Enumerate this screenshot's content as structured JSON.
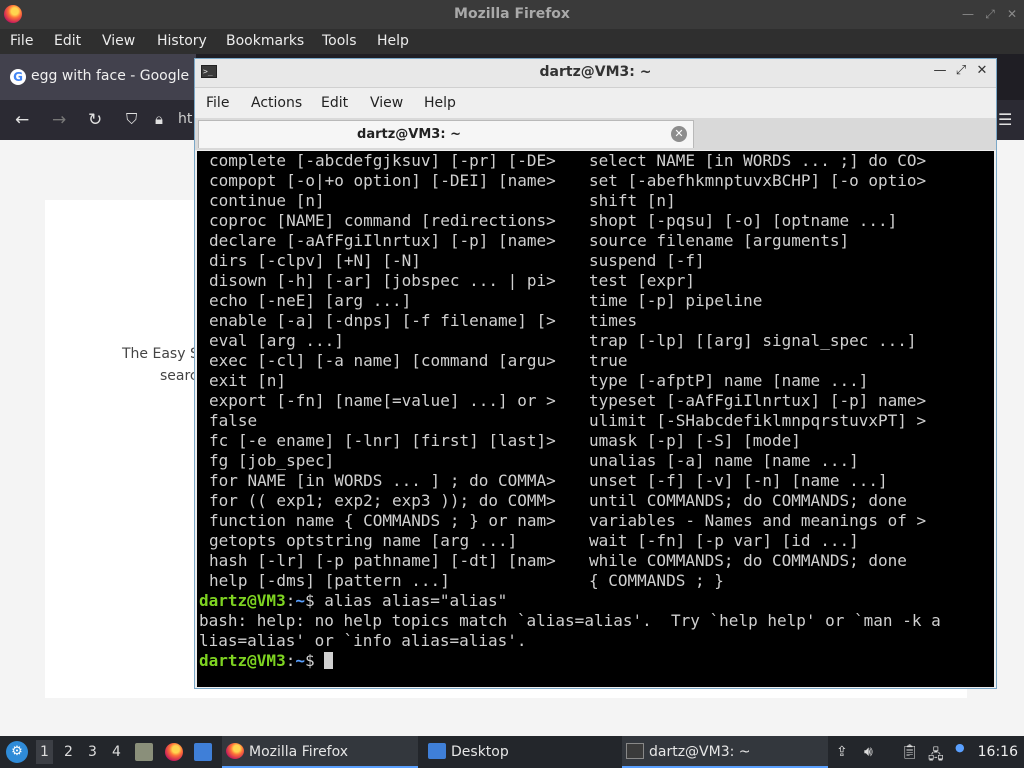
{
  "firefox": {
    "window_title": "Mozilla Firefox",
    "menu": [
      "File",
      "Edit",
      "View",
      "History",
      "Bookmarks",
      "Tools",
      "Help"
    ],
    "tab_title": "egg with face - Google S",
    "url_fragment": "ht",
    "page_text_1": "The Easy S",
    "page_text_2": "searc"
  },
  "terminal": {
    "window_title": "dartz@VM3: ~",
    "menu": [
      "File",
      "Actions",
      "Edit",
      "View",
      "Help"
    ],
    "tab_title": "dartz@VM3: ~",
    "help_rows": [
      [
        "complete [-abcdefgjksuv] [-pr] [-DE>",
        "select NAME [in WORDS ... ;] do CO>"
      ],
      [
        "compopt [-o|+o option] [-DEI] [name>",
        "set [-abefhkmnptuvxBCHP] [-o optio>"
      ],
      [
        "continue [n]",
        "shift [n]"
      ],
      [
        "coproc [NAME] command [redirections>",
        "shopt [-pqsu] [-o] [optname ...]"
      ],
      [
        "declare [-aAfFgiIlnrtux] [-p] [name>",
        "source filename [arguments]"
      ],
      [
        "dirs [-clpv] [+N] [-N]",
        "suspend [-f]"
      ],
      [
        "disown [-h] [-ar] [jobspec ... | pi>",
        "test [expr]"
      ],
      [
        "echo [-neE] [arg ...]",
        "time [-p] pipeline"
      ],
      [
        "enable [-a] [-dnps] [-f filename] [>",
        "times"
      ],
      [
        "eval [arg ...]",
        "trap [-lp] [[arg] signal_spec ...]"
      ],
      [
        "exec [-cl] [-a name] [command [argu>",
        "true"
      ],
      [
        "exit [n]",
        "type [-afptP] name [name ...]"
      ],
      [
        "export [-fn] [name[=value] ...] or >",
        "typeset [-aAfFgiIlnrtux] [-p] name>"
      ],
      [
        "false",
        "ulimit [-SHabcdefiklmnpqrstuvxPT] >"
      ],
      [
        "fc [-e ename] [-lnr] [first] [last]>",
        "umask [-p] [-S] [mode]"
      ],
      [
        "fg [job_spec]",
        "unalias [-a] name [name ...]"
      ],
      [
        "for NAME [in WORDS ... ] ; do COMMA>",
        "unset [-f] [-v] [-n] [name ...]"
      ],
      [
        "for (( exp1; exp2; exp3 )); do COMM>",
        "until COMMANDS; do COMMANDS; done"
      ],
      [
        "function name { COMMANDS ; } or nam>",
        "variables - Names and meanings of >"
      ],
      [
        "getopts optstring name [arg ...]",
        "wait [-fn] [-p var] [id ...]"
      ],
      [
        "hash [-lr] [-p pathname] [-dt] [nam>",
        "while COMMANDS; do COMMANDS; done"
      ],
      [
        "help [-dms] [pattern ...]",
        "{ COMMANDS ; }"
      ]
    ],
    "prompt_user": "dartz@VM3",
    "prompt_colon": ":",
    "prompt_path": "~",
    "prompt_symbol": "$",
    "command_1": " alias alias=\"alias\"",
    "output_1": "bash: help: no help topics match `alias=alias'.  Try `help help' or `man -k a",
    "output_2": "lias=alias' or `info alias=alias'.",
    "colors": {
      "prompt_user": "#7ed321",
      "prompt_path": "#5aa0ff",
      "background": "#000000",
      "text": "#d0d0d0"
    }
  },
  "taskbar": {
    "workspaces": [
      "1",
      "2",
      "3",
      "4"
    ],
    "tasks": [
      "Mozilla Firefox",
      "Desktop",
      "dartz@VM3: ~"
    ],
    "clock": "16:16"
  }
}
